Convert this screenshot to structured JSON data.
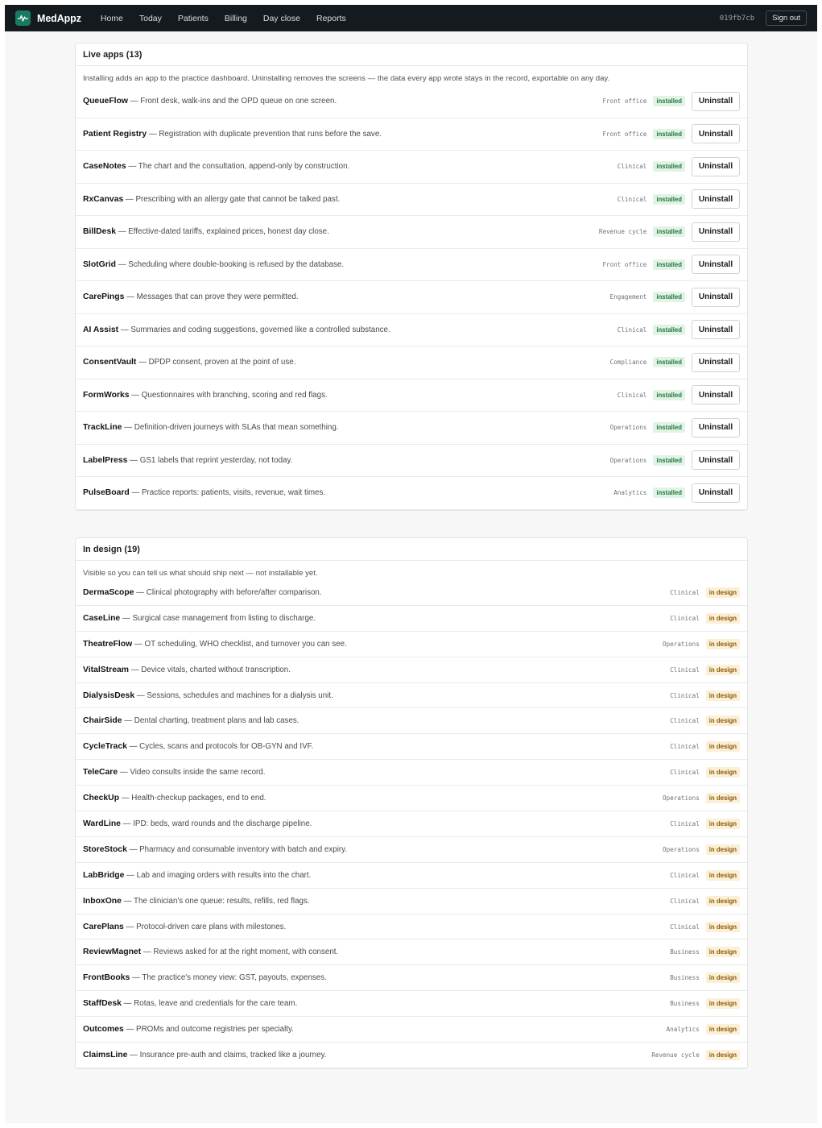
{
  "app": {
    "brand": "MedAppz",
    "nav": [
      "Home",
      "Today",
      "Patients",
      "Billing",
      "Day close",
      "Reports"
    ],
    "build_hash": "019fb7cb",
    "signout_label": "Sign out"
  },
  "live": {
    "title": "Live apps (13)",
    "intro": "Installing adds an app to the practice dashboard. Uninstalling removes the screens — the data every app wrote stays in the record, exportable on any day.",
    "status_label": "installed",
    "action_label": "Uninstall",
    "items": [
      {
        "name": "QueueFlow",
        "desc": " — Front desk, walk-ins and the OPD queue on one screen.",
        "category": "Front office"
      },
      {
        "name": "Patient Registry",
        "desc": " — Registration with duplicate prevention that runs before the save.",
        "category": "Front office"
      },
      {
        "name": "CaseNotes",
        "desc": " — The chart and the consultation, append-only by construction.",
        "category": "Clinical"
      },
      {
        "name": "RxCanvas",
        "desc": " — Prescribing with an allergy gate that cannot be talked past.",
        "category": "Clinical"
      },
      {
        "name": "BillDesk",
        "desc": " — Effective-dated tariffs, explained prices, honest day close.",
        "category": "Revenue cycle"
      },
      {
        "name": "SlotGrid",
        "desc": " — Scheduling where double-booking is refused by the database.",
        "category": "Front office"
      },
      {
        "name": "CarePings",
        "desc": " — Messages that can prove they were permitted.",
        "category": "Engagement"
      },
      {
        "name": "AI Assist",
        "desc": " — Summaries and coding suggestions, governed like a controlled substance.",
        "category": "Clinical"
      },
      {
        "name": "ConsentVault",
        "desc": " — DPDP consent, proven at the point of use.",
        "category": "Compliance"
      },
      {
        "name": "FormWorks",
        "desc": " — Questionnaires with branching, scoring and red flags.",
        "category": "Clinical"
      },
      {
        "name": "TrackLine",
        "desc": " — Definition-driven journeys with SLAs that mean something.",
        "category": "Operations"
      },
      {
        "name": "LabelPress",
        "desc": " — GS1 labels that reprint yesterday, not today.",
        "category": "Operations"
      },
      {
        "name": "PulseBoard",
        "desc": " — Practice reports: patients, visits, revenue, wait times.",
        "category": "Analytics"
      }
    ]
  },
  "design": {
    "title": "In design (19)",
    "intro": "Visible so you can tell us what should ship next — not installable yet.",
    "status_label": "in design",
    "items": [
      {
        "name": "DermaScope",
        "desc": " — Clinical photography with before/after comparison.",
        "category": "Clinical"
      },
      {
        "name": "CaseLine",
        "desc": " — Surgical case management from listing to discharge.",
        "category": "Clinical"
      },
      {
        "name": "TheatreFlow",
        "desc": " — OT scheduling, WHO checklist, and turnover you can see.",
        "category": "Operations"
      },
      {
        "name": "VitalStream",
        "desc": " — Device vitals, charted without transcription.",
        "category": "Clinical"
      },
      {
        "name": "DialysisDesk",
        "desc": " — Sessions, schedules and machines for a dialysis unit.",
        "category": "Clinical"
      },
      {
        "name": "ChairSide",
        "desc": " — Dental charting, treatment plans and lab cases.",
        "category": "Clinical"
      },
      {
        "name": "CycleTrack",
        "desc": " — Cycles, scans and protocols for OB-GYN and IVF.",
        "category": "Clinical"
      },
      {
        "name": "TeleCare",
        "desc": " — Video consults inside the same record.",
        "category": "Clinical"
      },
      {
        "name": "CheckUp",
        "desc": " — Health-checkup packages, end to end.",
        "category": "Operations"
      },
      {
        "name": "WardLine",
        "desc": " — IPD: beds, ward rounds and the discharge pipeline.",
        "category": "Clinical"
      },
      {
        "name": "StoreStock",
        "desc": " — Pharmacy and consumable inventory with batch and expiry.",
        "category": "Operations"
      },
      {
        "name": "LabBridge",
        "desc": " — Lab and imaging orders with results into the chart.",
        "category": "Clinical"
      },
      {
        "name": "InboxOne",
        "desc": " — The clinician's one queue: results, refills, red flags.",
        "category": "Clinical"
      },
      {
        "name": "CarePlans",
        "desc": " — Protocol-driven care plans with milestones.",
        "category": "Clinical"
      },
      {
        "name": "ReviewMagnet",
        "desc": " — Reviews asked for at the right moment, with consent.",
        "category": "Business"
      },
      {
        "name": "FrontBooks",
        "desc": " — The practice's money view: GST, payouts, expenses.",
        "category": "Business"
      },
      {
        "name": "StaffDesk",
        "desc": " — Rotas, leave and credentials for the care team.",
        "category": "Business"
      },
      {
        "name": "Outcomes",
        "desc": " — PROMs and outcome registries per specialty.",
        "category": "Analytics"
      },
      {
        "name": "ClaimsLine",
        "desc": " — Insurance pre-auth and claims, tracked like a journey.",
        "category": "Revenue cycle"
      }
    ]
  }
}
